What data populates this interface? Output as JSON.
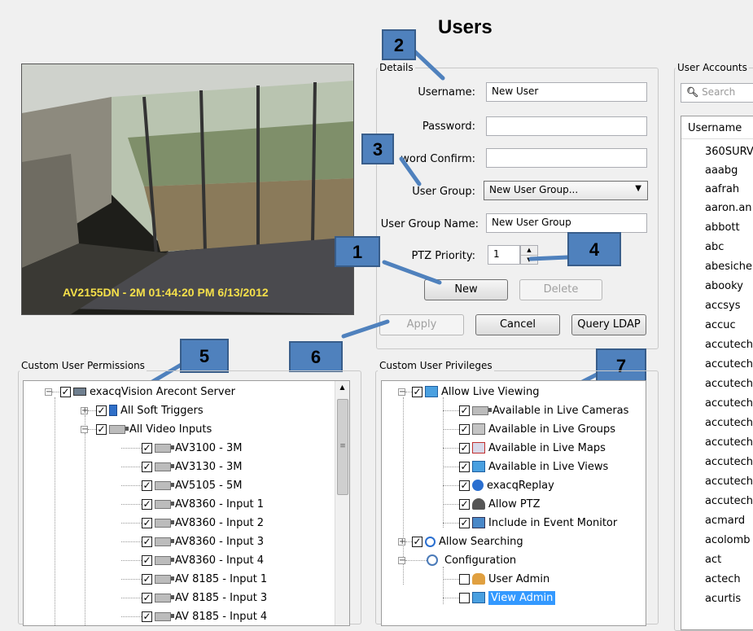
{
  "title": "Users",
  "camera": {
    "overlay": "AV2155DN - 2M 01:44:20 PM 6/13/2012"
  },
  "details": {
    "group_label": "Details",
    "username_label": "Username:",
    "username_value": "New User",
    "password_label": "Password:",
    "password_confirm_label": "word Confirm:",
    "user_group_label": "User Group:",
    "user_group_value": "New User Group...",
    "user_group_name_label": "User Group Name:",
    "user_group_name_value": "New User Group",
    "ptz_label": "PTZ Priority:",
    "ptz_value": "1",
    "new_button": "New",
    "delete_button": "Delete"
  },
  "actions": {
    "apply": "Apply",
    "cancel": "Cancel",
    "query_ldap": "Query LDAP"
  },
  "callouts": [
    "1",
    "2",
    "3",
    "4",
    "5",
    "6",
    "7"
  ],
  "permissions": {
    "group_label": "Custom User Permissions",
    "items": [
      "exacqVision Arecont Server",
      "All Soft Triggers",
      "All Video Inputs",
      "AV3100 - 3M",
      "AV3130 - 3M",
      "AV5105 - 5M",
      "AV8360 - Input 1",
      "AV8360 - Input 2",
      "AV8360 - Input 3",
      "AV8360 - Input 4",
      "AV 8185 - Input 1",
      "AV 8185 - Input 3",
      "AV 8185 - Input 4"
    ]
  },
  "privileges": {
    "group_label": "Custom User Privileges",
    "items": [
      "Allow Live Viewing",
      "Available in Live Cameras",
      "Available in Live Groups",
      "Available in Live Maps",
      "Available in Live Views",
      "exacqReplay",
      "Allow PTZ",
      "Include in Event Monitor",
      "Allow Searching",
      "Configuration",
      "User Admin",
      "View Admin"
    ]
  },
  "accounts": {
    "group_label": "User Accounts",
    "search_placeholder": "Search",
    "column_header": "Username",
    "users": [
      "360SURV",
      "aaabg",
      "aafrah",
      "aaron.an",
      "abbott",
      "abc",
      "abesiche",
      "abooky",
      "accsys",
      "accuc",
      "accutech",
      "accutech",
      "accutech",
      "accutech",
      "accutech",
      "accutech",
      "accutech",
      "accutech",
      "accutech",
      "acmard",
      "acolomb",
      "act",
      "actech",
      "acurtis"
    ]
  }
}
